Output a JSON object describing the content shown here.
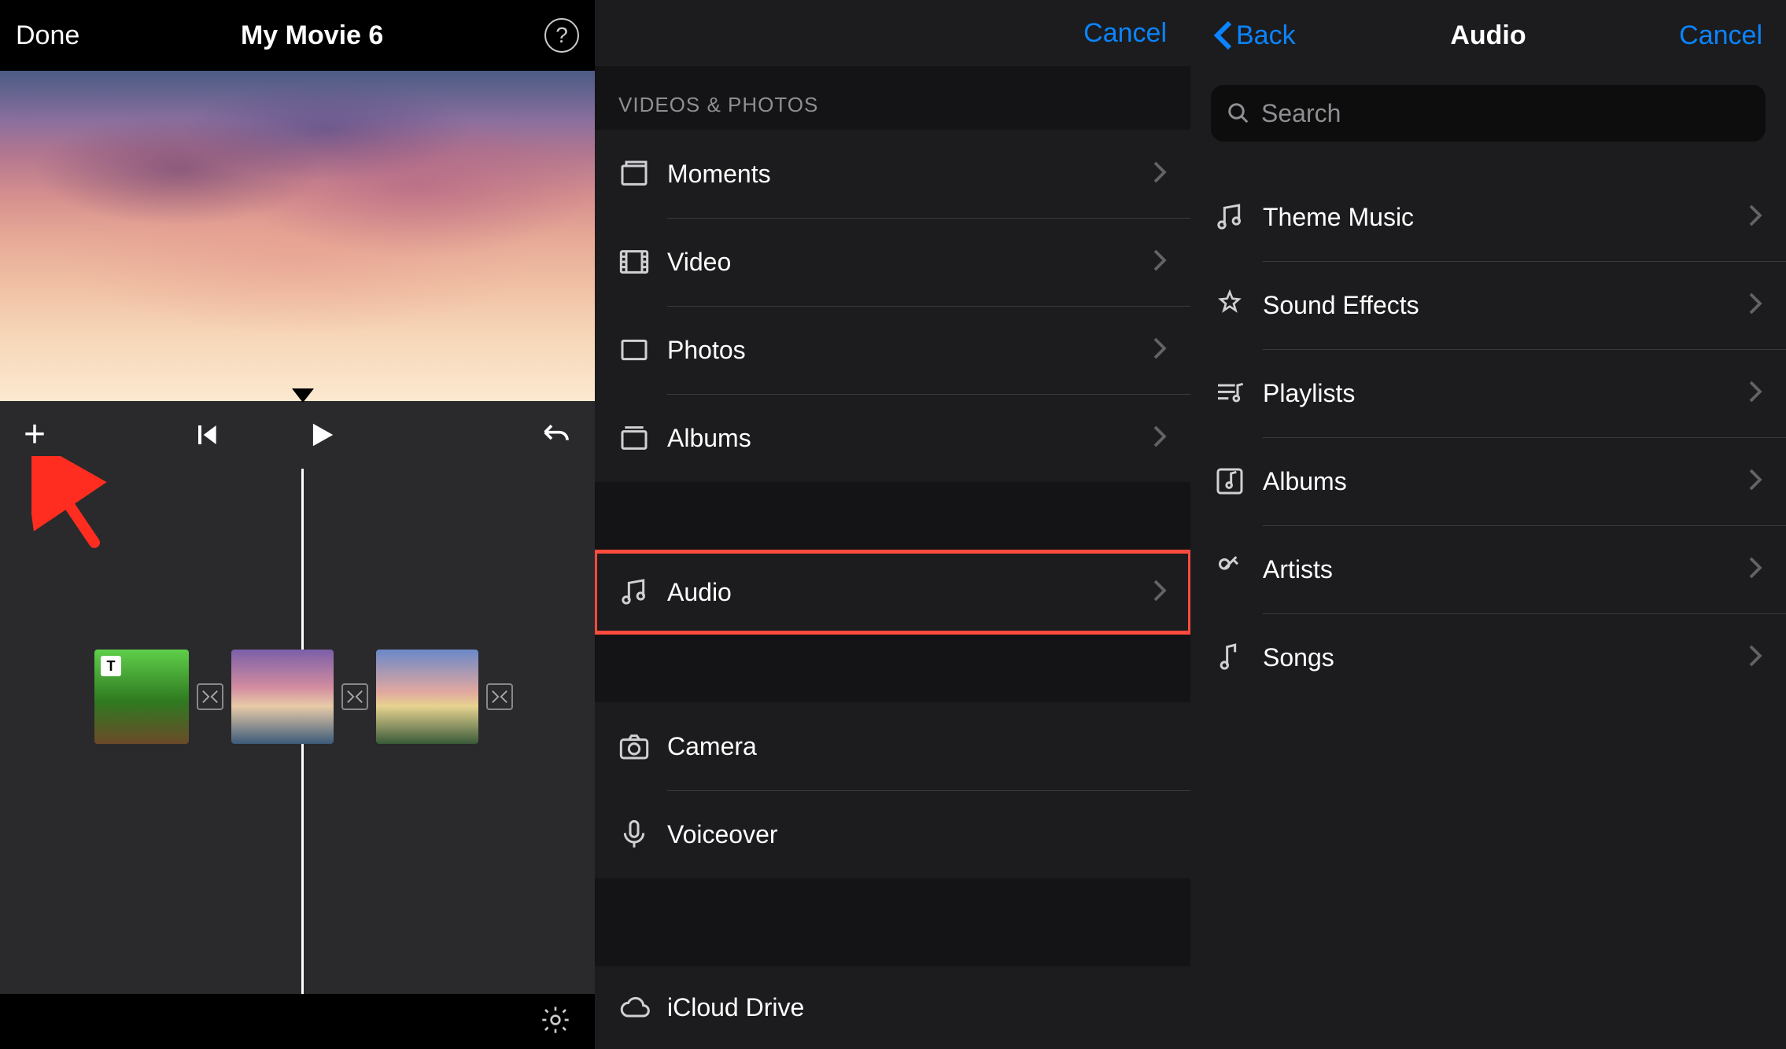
{
  "screen1": {
    "done": "Done",
    "title": "My Movie 6",
    "help_symbol": "?"
  },
  "screen2": {
    "cancel": "Cancel",
    "section_header": "VIDEOS & PHOTOS",
    "rows_media": [
      {
        "label": "Moments"
      },
      {
        "label": "Video"
      },
      {
        "label": "Photos"
      },
      {
        "label": "Albums"
      }
    ],
    "row_audio": {
      "label": "Audio"
    },
    "rows_capture": [
      {
        "label": "Camera"
      },
      {
        "label": "Voiceover"
      }
    ],
    "row_icloud": {
      "label": "iCloud Drive"
    }
  },
  "screen3": {
    "back": "Back",
    "title": "Audio",
    "cancel": "Cancel",
    "search_placeholder": "Search",
    "rows": [
      {
        "label": "Theme Music"
      },
      {
        "label": "Sound Effects"
      },
      {
        "label": "Playlists"
      },
      {
        "label": "Albums"
      },
      {
        "label": "Artists"
      },
      {
        "label": "Songs"
      }
    ]
  }
}
